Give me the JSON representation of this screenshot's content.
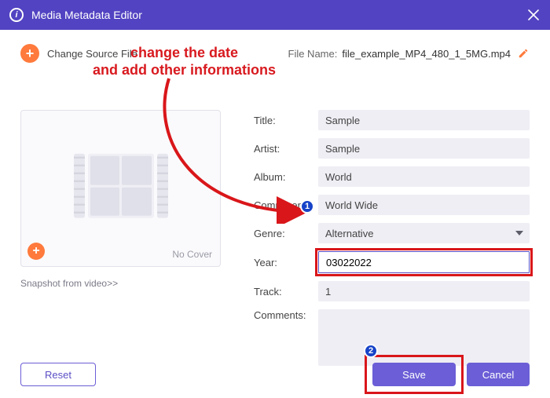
{
  "window": {
    "title": "Media Metadata Editor"
  },
  "header": {
    "change_source": "Change Source File",
    "filename_label": "File Name:",
    "filename_value": "file_example_MP4_480_1_5MG.mp4"
  },
  "cover": {
    "no_cover": "No Cover",
    "snapshot_link": "Snapshot from video>>"
  },
  "fields": {
    "title": {
      "label": "Title:",
      "value": "Sample"
    },
    "artist": {
      "label": "Artist:",
      "value": "Sample"
    },
    "album": {
      "label": "Album:",
      "value": "World"
    },
    "composer": {
      "label": "Composer:",
      "value": "World Wide"
    },
    "genre": {
      "label": "Genre:",
      "selected": "Alternative"
    },
    "year": {
      "label": "Year:",
      "value": "03022022"
    },
    "track": {
      "label": "Track:",
      "value": "1"
    },
    "comments": {
      "label": "Comments:",
      "value": ""
    }
  },
  "buttons": {
    "reset": "Reset",
    "save": "Save",
    "cancel": "Cancel"
  },
  "annotation": {
    "line1": "change the date",
    "line2": "and add other informations",
    "badge1": "1",
    "badge2": "2"
  }
}
